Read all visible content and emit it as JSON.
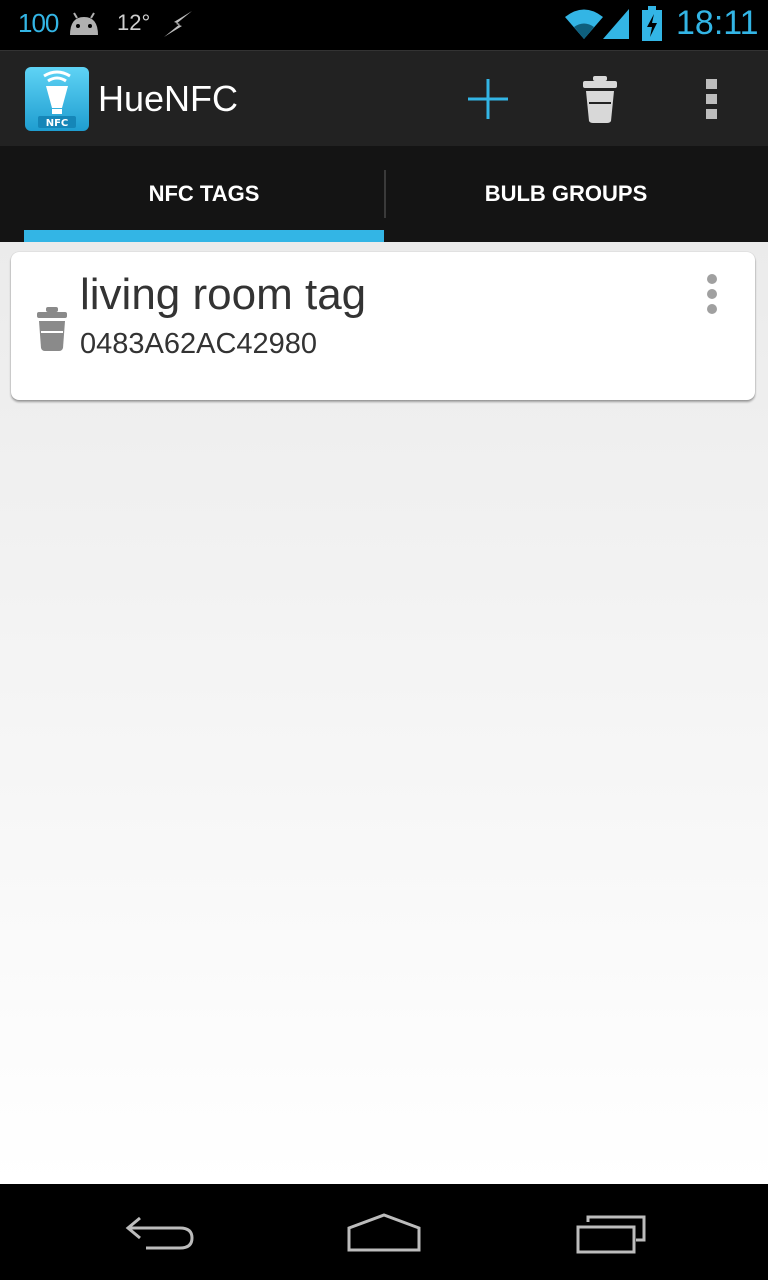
{
  "status_bar": {
    "battery_level": "100",
    "temperature": "12°",
    "time": "18:11",
    "icons": [
      "android-icon",
      "lightning-icon",
      "wifi-icon",
      "signal-icon",
      "battery-charging-icon"
    ]
  },
  "action_bar": {
    "title": "HueNFC",
    "icons": [
      "app-logo-icon",
      "add-icon",
      "trash-icon",
      "overflow-menu-icon"
    ]
  },
  "tabs": [
    {
      "label": "NFC TAGS",
      "selected": true
    },
    {
      "label": "BULB GROUPS",
      "selected": false
    }
  ],
  "tags": [
    {
      "name": "living room tag",
      "id": "0483A62AC42980"
    }
  ],
  "nav_bar": {
    "icons": [
      "back-icon",
      "home-icon",
      "recents-icon"
    ]
  },
  "colors": {
    "accent": "#33b5e5",
    "action_bar_bg": "#222222",
    "tab_bar_bg": "#141414",
    "content_bg": "#f2f2f2"
  }
}
